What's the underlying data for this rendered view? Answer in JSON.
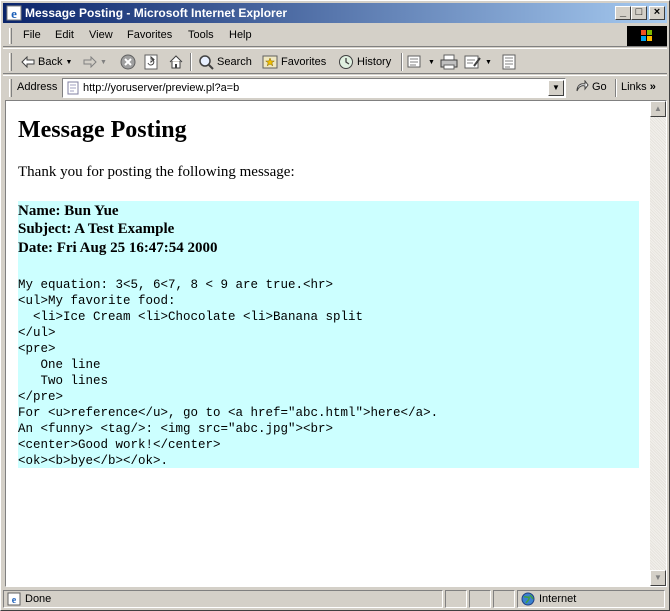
{
  "window": {
    "title": "Message Posting - Microsoft Internet Explorer"
  },
  "menu": [
    "File",
    "Edit",
    "View",
    "Favorites",
    "Tools",
    "Help"
  ],
  "toolbar": {
    "back": "Back",
    "search": "Search",
    "favorites": "Favorites",
    "history": "History"
  },
  "address": {
    "label": "Address",
    "url": "http://yoruserver/preview.pl?a=b",
    "go": "Go",
    "links": "Links"
  },
  "page": {
    "heading": "Message Posting",
    "thanks": "Thank you for posting the following message:",
    "name_line": "Name: Bun Yue",
    "subject_line": "Subject: A Test Example",
    "date_line": "Date: Fri Aug 25 16:47:54 2000",
    "body": "My equation: 3<5, 6<7, 8 < 9 are true.<hr>\n<ul>My favorite food:\n  <li>Ice Cream <li>Chocolate <li>Banana split\n</ul>\n<pre>\n   One line\n   Two lines\n</pre>\nFor <u>reference</u>, go to <a href=\"abc.html\">here</a>.\nAn <funny> <tag/>: <img src=\"abc.jpg\"><br>\n<center>Good work!</center>\n<ok><b>bye</b></ok>."
  },
  "status": {
    "text": "Done",
    "zone": "Internet"
  },
  "colors": {
    "message_bg": "#ccffff",
    "titlebar_start": "#0a246a",
    "titlebar_end": "#a6caf0"
  }
}
